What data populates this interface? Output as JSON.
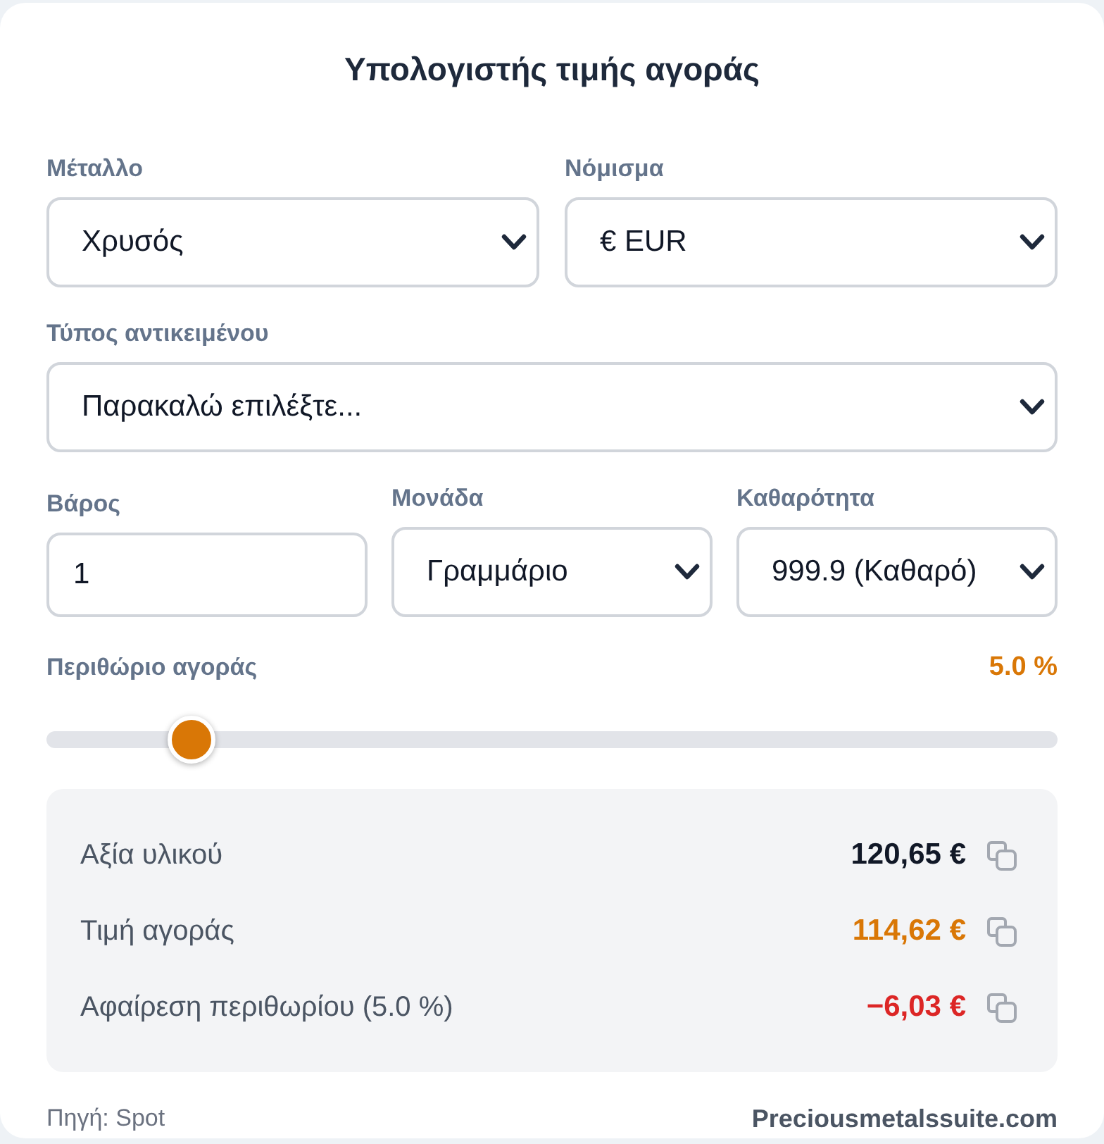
{
  "title": "Υπολογιστής τιμής αγοράς",
  "form_rows": [
    [
      {
        "kind": "select",
        "label": "Μέταλλο",
        "value": "Χρυσός"
      },
      {
        "kind": "select",
        "label": "Νόμισμα",
        "value": "€ EUR"
      }
    ],
    [
      {
        "kind": "select",
        "label": "Τύπος αντικειμένου",
        "value": "Παρακαλώ επιλέξτε..."
      }
    ],
    [
      {
        "kind": "input",
        "label": "Βάρος",
        "value": "1"
      },
      {
        "kind": "select",
        "label": "Μονάδα",
        "value": "Γραμμάριο"
      },
      {
        "kind": "select",
        "label": "Καθαρότητα",
        "value": "999.9 (Καθαρό)"
      }
    ]
  ],
  "margin": {
    "label": "Περιθώριο αγοράς",
    "reading": "5.0 %",
    "level": 0.143
  },
  "results": [
    {
      "label": "Αξία υλικού",
      "value": "120,65 €",
      "color": "#111827"
    },
    {
      "label": "Τιμή αγοράς",
      "value": "114,62 €",
      "color": "#d97706"
    },
    {
      "label": "Αφαίρεση περιθωρίου (5.0 %)",
      "value": "−6,03 €",
      "color": "#dc2626"
    }
  ],
  "footer": {
    "source": "Πηγή: Spot",
    "site": "Preciousmetalssuite.com"
  }
}
